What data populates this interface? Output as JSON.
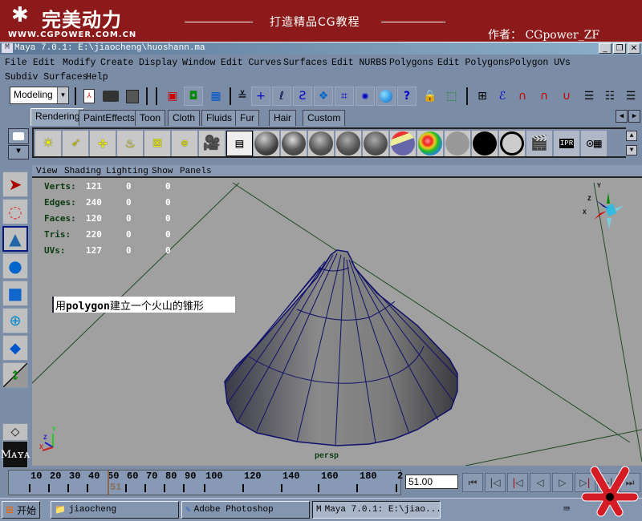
{
  "banner": {
    "brand": "完美动力",
    "url": "WWW.CGPOWER.COM.CN",
    "slogan": "打造精品CG教程",
    "author": "作者： CGpower_ZF",
    "bg_color": "#8c1a1a"
  },
  "window": {
    "title": "Maya 7.0.1: E:\\jiaocheng\\huoshann.ma",
    "controls": {
      "minimize": "_",
      "restore": "❐",
      "close": "✕"
    }
  },
  "menubar": {
    "items": [
      "File",
      "Edit",
      "Modify",
      "Create",
      "Display",
      "Window",
      "Edit Curves",
      "Surfaces",
      "Edit NURBS",
      "Polygons",
      "Edit Polygons",
      "Polygon UVs",
      "Subdiv Surfaces",
      "Help"
    ]
  },
  "toolbar": {
    "mode_selected": "Modeling",
    "icons": [
      "new-scene-icon",
      "open-scene-icon",
      "save-scene-icon",
      "select-hierarchy-icon",
      "select-object-icon",
      "select-component-icon",
      "collapse-icon",
      "select-point-icon",
      "select-edge-icon",
      "select-curve-icon",
      "select-surface-icon",
      "select-deformer-icon",
      "select-dynamic-icon",
      "select-render-icon",
      "help-icon",
      "lock-icon",
      "select-highlight-icon",
      "snap-grid-icon",
      "snap-curve-icon",
      "snap-point-icon",
      "snap-view-icon",
      "make-live-icon",
      "history-icon",
      "render-globals-icon",
      "channel-box-icon"
    ]
  },
  "shelf": {
    "tabs": [
      "Rendering",
      "PaintEffects",
      "Toon",
      "Cloth",
      "Fluids",
      "Fur",
      "Hair",
      "Custom"
    ],
    "active_tab": "Rendering",
    "items": [
      "ambient-light-icon",
      "directional-light-icon",
      "point-light-icon",
      "spot-light-icon",
      "area-light-icon",
      "volume-light-icon",
      "camera-icon",
      "hypershade-icon",
      "blinn-icon",
      "phong-icon",
      "phonge-icon",
      "lambert-icon",
      "anisotropic-icon",
      "ramp-shader-icon",
      "layered-shader-icon",
      "surface-shader-icon",
      "use-background-icon",
      "render-icon",
      "ipr-render-icon",
      "batch-render-icon"
    ]
  },
  "tools": [
    "select-tool-icon",
    "lasso-tool-icon",
    "paint-select-tool-icon",
    "rotate-tool-icon",
    "scale-tool-icon",
    "universal-manipulator-icon",
    "soft-modify-icon",
    "show-manipulator-icon"
  ],
  "viewport": {
    "menu": [
      "View",
      "Shading",
      "Lighting",
      "Show",
      "Panels"
    ],
    "hud": [
      {
        "label": "Verts:",
        "values": [
          "121",
          "0",
          "0"
        ]
      },
      {
        "label": "Edges:",
        "values": [
          "240",
          "0",
          "0"
        ]
      },
      {
        "label": "Faces:",
        "values": [
          "120",
          "0",
          "0"
        ]
      },
      {
        "label": "Tris:",
        "values": [
          "220",
          "0",
          "0"
        ]
      },
      {
        "label": "UVs:",
        "values": [
          "127",
          "0",
          "0"
        ]
      }
    ],
    "annotation_prefix": "用",
    "annotation_bold": "polygon",
    "annotation_suffix": "建立一个火山的锥形",
    "camera": "persp",
    "axis_labels": {
      "x": "X",
      "y": "Y",
      "z": "Z"
    }
  },
  "timeline": {
    "ticks": [
      "10",
      "20",
      "30",
      "40",
      "50",
      "60",
      "70",
      "80",
      "90",
      "100",
      "120",
      "140",
      "160",
      "180",
      "2"
    ],
    "current_frame_label": "51",
    "current_frame_value": "51.00"
  },
  "playback": {
    "buttons": [
      "go-to-start-icon",
      "step-back-key-icon",
      "step-back-frame-icon",
      "play-backward-icon",
      "play-forward-icon",
      "step-forward-frame-icon",
      "step-forward-key-icon",
      "go-to-end-icon"
    ]
  },
  "taskbar": {
    "start": "开始",
    "tasks": [
      {
        "label": "jiaocheng",
        "icon": "folder-icon"
      },
      {
        "label": "Adobe Photoshop",
        "icon": "photoshop-icon"
      },
      {
        "label": "Maya 7.0.1: E:\\jiao...",
        "icon": "maya-icon"
      }
    ]
  }
}
